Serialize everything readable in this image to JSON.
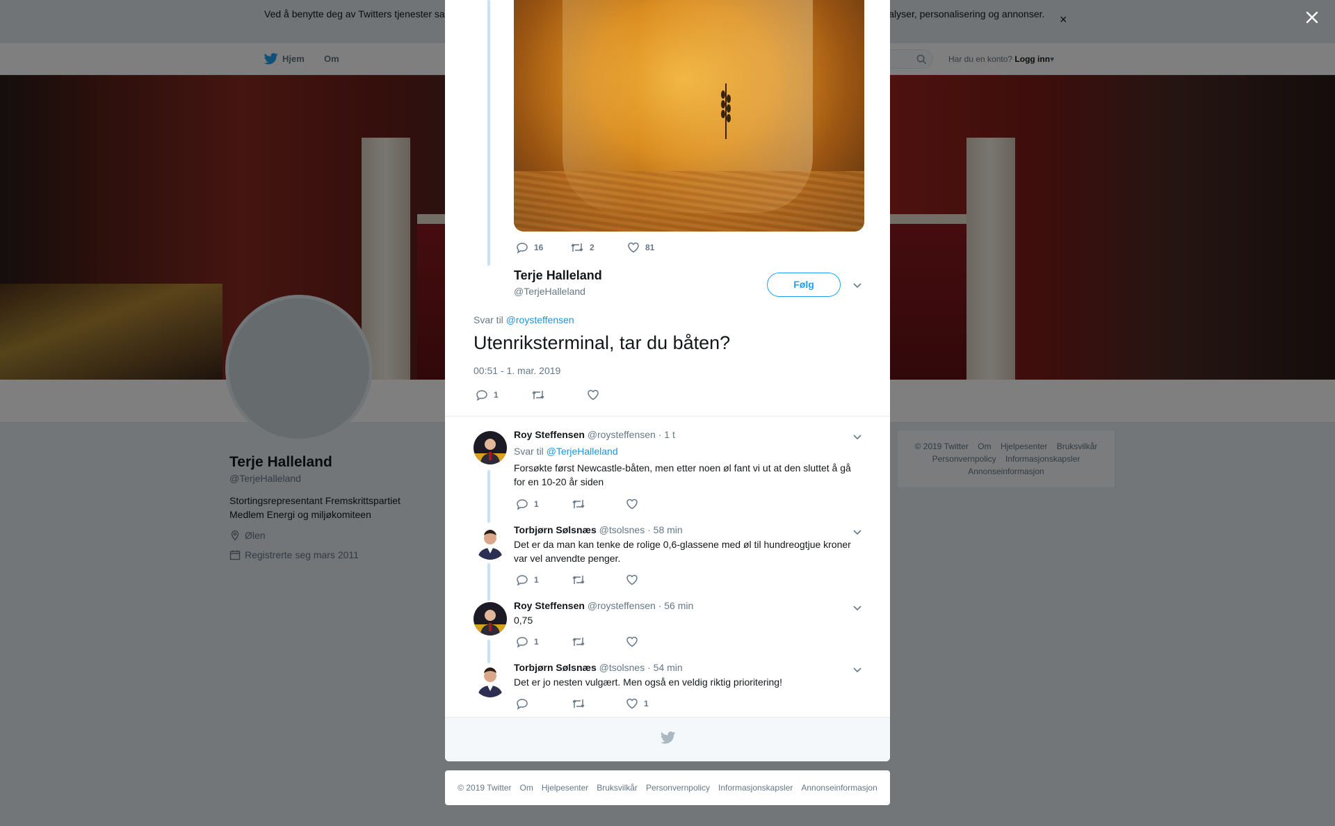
{
  "cookie": {
    "text": "Ved å benytte deg av Twitters tjenester samtykker du i vår bruk av informasjonskapsler. Vi og våre partnere bruker informasjonskapsler til bl.a. analyser, personalisering og annonser.",
    "close_label": "×"
  },
  "nav": {
    "home": "Hjem",
    "about": "Om",
    "account_prompt": "Har du en konto?",
    "login": "Logg inn"
  },
  "profile": {
    "name": "Terje Halleland",
    "handle": "@TerjeHalleland",
    "bio_line1": "Stortingsrepresentant Fremskrittspartiet",
    "bio_line2": "Medlem Energi og miljøkomiteen",
    "location": "Ølen",
    "joined": "Registrerte seg mars 2011"
  },
  "side_footer": {
    "links": [
      "© 2019 Twitter",
      "Om",
      "Hjelpesenter",
      "Bruksvilkår",
      "Personvernpolicy",
      "Informasjonskapsler",
      "Annonseinformasjon"
    ]
  },
  "parent_tweet": {
    "replies": "16",
    "retweets": "2",
    "likes": "81"
  },
  "main_tweet": {
    "name": "Terje Halleland",
    "handle": "@TerjeHalleland",
    "follow_label": "Følg",
    "reply_prefix": "Svar til",
    "reply_to": "@roysteffensen",
    "text": "Utenriksterminal, tar du båten?",
    "timestamp": "00:51 - 1. mar. 2019",
    "replies": "1",
    "retweets": "",
    "likes": ""
  },
  "replies": [
    {
      "name": "Roy Steffensen",
      "handle": "@roysteffensen",
      "time": "· 1 t",
      "reply_prefix": "Svar til",
      "reply_to": "@TerjeHalleland",
      "text": "Forsøkte først Newcastle-båten, men etter noen øl fant vi ut at den sluttet å gå for en 10-20 år siden",
      "replies": "1",
      "retweets": "",
      "likes": ""
    },
    {
      "name": "Torbjørn Sølsnæs",
      "handle": "@tsolsnes",
      "time": "· 58 min",
      "text": "Det er da man kan tenke de rolige 0,6-glassene med øl til hundreogtjue kroner var vel anvendte penger.",
      "replies": "1",
      "retweets": "",
      "likes": ""
    },
    {
      "name": "Roy Steffensen",
      "handle": "@roysteffensen",
      "time": "· 56 min",
      "text": "0,75",
      "replies": "1",
      "retweets": "",
      "likes": ""
    },
    {
      "name": "Torbjørn Sølsnæs",
      "handle": "@tsolsnes",
      "time": "· 54 min",
      "text": "Det er jo nesten vulgært. Men også en veldig riktig prioritering!",
      "replies": "",
      "retweets": "",
      "likes": "1"
    }
  ],
  "bottom_footer": {
    "links": [
      "© 2019 Twitter",
      "Om",
      "Hjelpesenter",
      "Bruksvilkår",
      "Personvernpolicy",
      "Informasjonskapsler",
      "Annonseinformasjon"
    ]
  },
  "colors": {
    "accent": "#1da1f2",
    "link": "#1b95e0",
    "thread": "#c4e3f8",
    "muted": "#657786"
  }
}
